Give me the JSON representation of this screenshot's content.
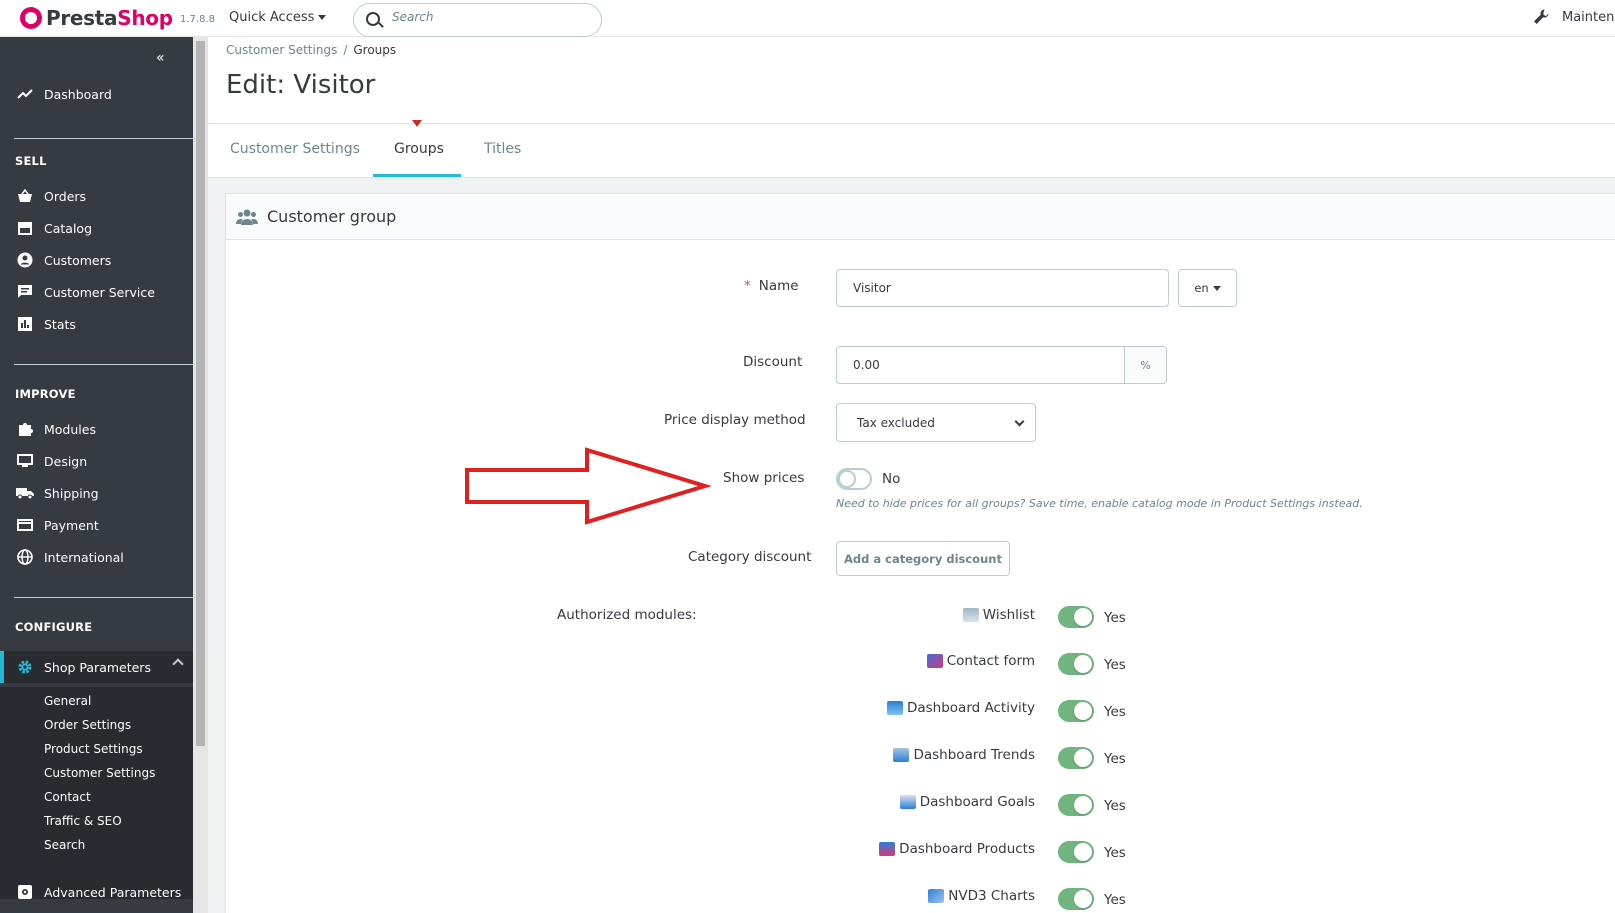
{
  "header": {
    "logo_prefix": "Presta",
    "logo_suffix": "Shop",
    "version": "1.7.8.8",
    "quick_access": "Quick Access",
    "search_placeholder": "Search",
    "maintenance": "Maintena"
  },
  "sidebar": {
    "dashboard": "Dashboard",
    "sell_heading": "SELL",
    "sell_items": [
      "Orders",
      "Catalog",
      "Customers",
      "Customer Service",
      "Stats"
    ],
    "improve_heading": "IMPROVE",
    "improve_items": [
      "Modules",
      "Design",
      "Shipping",
      "Payment",
      "International"
    ],
    "configure_heading": "CONFIGURE",
    "shop_parameters": "Shop Parameters",
    "shop_parameters_sub": [
      "General",
      "Order Settings",
      "Product Settings",
      "Customer Settings",
      "Contact",
      "Traffic & SEO",
      "Search"
    ],
    "advanced_parameters": "Advanced Parameters"
  },
  "breadcrumb": {
    "parent": "Customer Settings",
    "separator": "/",
    "current": "Groups"
  },
  "page_title": "Edit: Visitor",
  "tabs": [
    "Customer Settings",
    "Groups",
    "Titles"
  ],
  "card": {
    "title": "Customer group",
    "name_label": "Name",
    "required_mark": "*",
    "name_value": "Visitor",
    "lang": "en",
    "discount_label": "Discount",
    "discount_value": "0.00",
    "discount_unit": "%",
    "price_display_label": "Price display method",
    "price_display_value": "Tax excluded",
    "show_prices_label": "Show prices",
    "show_prices_state": "No",
    "show_prices_help": "Need to hide prices for all groups? Save time, enable catalog mode in Product Settings instead.",
    "category_discount_label": "Category discount",
    "add_category_discount": "Add a category discount",
    "authorized_modules_label": "Authorized modules:",
    "modules": [
      {
        "name": "Wishlist",
        "state": "Yes"
      },
      {
        "name": "Contact form",
        "state": "Yes"
      },
      {
        "name": "Dashboard Activity",
        "state": "Yes"
      },
      {
        "name": "Dashboard Trends",
        "state": "Yes"
      },
      {
        "name": "Dashboard Goals",
        "state": "Yes"
      },
      {
        "name": "Dashboard Products",
        "state": "Yes"
      },
      {
        "name": "NVD3 Charts",
        "state": "Yes"
      }
    ]
  },
  "colors": {
    "brand": "#df0067",
    "accent": "#25b9d7",
    "toggle_on": "#70b580",
    "annotation_arrow": "#e02020"
  }
}
